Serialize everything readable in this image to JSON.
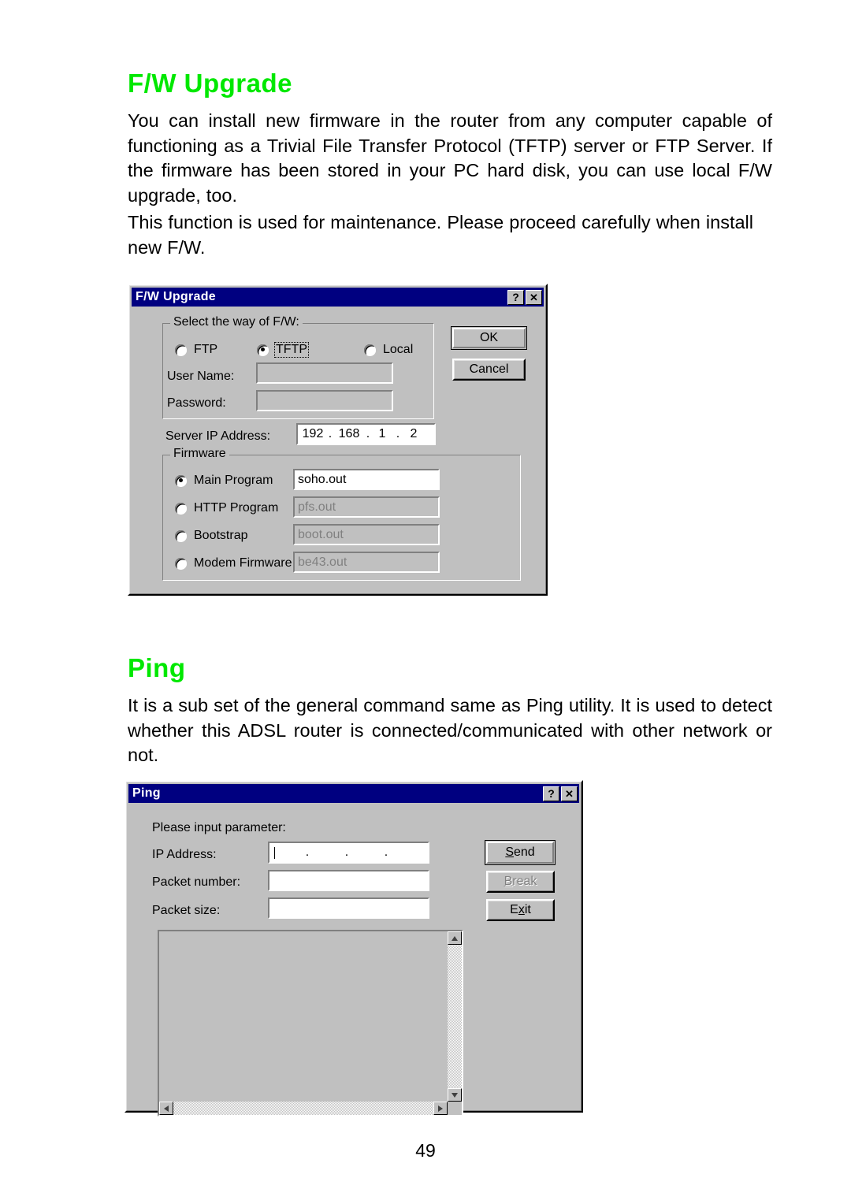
{
  "page": {
    "number": "49"
  },
  "sections": [
    {
      "heading": "F/W Upgrade",
      "paragraphs": [
        "You can install new firmware in the router from any computer capable of functioning as a Trivial File Transfer Protocol (TFTP) server or FTP Server.  If the firmware has been stored in your PC hard disk, you can use local F/W upgrade, too.",
        "This function is used for maintenance.  Please proceed carefully when install new F/W."
      ]
    },
    {
      "heading": "Ping",
      "paragraphs": [
        "It is a sub set of the general command same as Ping utility.  It is used to detect whether this ADSL router is connected/communicated with other network or not."
      ]
    }
  ],
  "fw_dialog": {
    "title": "F/W Upgrade",
    "help_button": "?",
    "close_button": "✕",
    "way_group": {
      "label": "Select the way of F/W:",
      "options": [
        {
          "label": "FTP",
          "checked": false,
          "focused": false
        },
        {
          "label": "TFTP",
          "checked": true,
          "focused": true
        },
        {
          "label": "Local",
          "checked": false,
          "focused": false
        }
      ],
      "user_name_label": "User Name:",
      "user_name_value": "",
      "password_label": "Password:",
      "password_value": ""
    },
    "server_ip": {
      "label": "Server IP Address:",
      "octets": [
        "192",
        "168",
        "1",
        "2"
      ],
      "separator": "."
    },
    "firmware_group": {
      "label": "Firmware",
      "rows": [
        {
          "label": "Main Program",
          "checked": true,
          "value": "soho.out",
          "disabled": false
        },
        {
          "label": "HTTP Program",
          "checked": false,
          "value": "pfs.out",
          "disabled": true
        },
        {
          "label": "Bootstrap",
          "checked": false,
          "value": "boot.out",
          "disabled": true
        },
        {
          "label": "Modem Firmware",
          "checked": false,
          "value": "be43.out",
          "disabled": true
        }
      ]
    },
    "buttons": {
      "ok": "OK",
      "cancel": "Cancel"
    }
  },
  "ping_dialog": {
    "title": "Ping",
    "help_button": "?",
    "close_button": "✕",
    "prompt": "Please input parameter:",
    "fields": [
      {
        "label": "IP Address:",
        "value": ""
      },
      {
        "label": "Packet number:",
        "value": ""
      },
      {
        "label": "Packet size:",
        "value": ""
      }
    ],
    "ip_separator": ".",
    "buttons": [
      {
        "label": "Send",
        "accel": "S",
        "disabled": false,
        "default": true
      },
      {
        "label": "Break",
        "accel": "B",
        "disabled": true,
        "default": false
      },
      {
        "label": "Exit",
        "accel": "x",
        "disabled": false,
        "default": false
      }
    ],
    "output_value": ""
  },
  "colors": {
    "heading_green": "#00e800",
    "titlebar_blue": "#000080",
    "dialog_face": "#c0c0c0"
  }
}
